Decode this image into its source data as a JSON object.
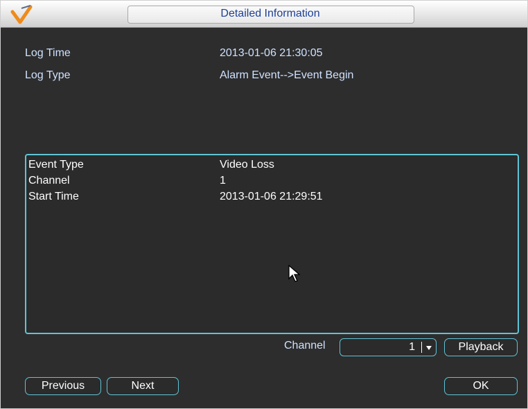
{
  "window": {
    "title": "Detailed Information"
  },
  "info": [
    {
      "label": "Log Time",
      "value": "2013-01-06 21:30:05"
    },
    {
      "label": "Log Type",
      "value": "Alarm Event-->Event Begin"
    }
  ],
  "details": [
    {
      "label": "Event Type",
      "value": "Video Loss"
    },
    {
      "label": "Channel",
      "value": "1"
    },
    {
      "label": "Start Time",
      "value": "2013-01-06 21:29:51"
    }
  ],
  "controls": {
    "channel_label": "Channel",
    "channel_value": "1",
    "playback_label": "Playback",
    "previous_label": "Previous",
    "next_label": "Next",
    "ok_label": "OK"
  },
  "colors": {
    "accent": "#5fc4d6",
    "title_text": "#1d3f95",
    "info_text": "#cfe2ff",
    "background": "#2d2d2d"
  }
}
